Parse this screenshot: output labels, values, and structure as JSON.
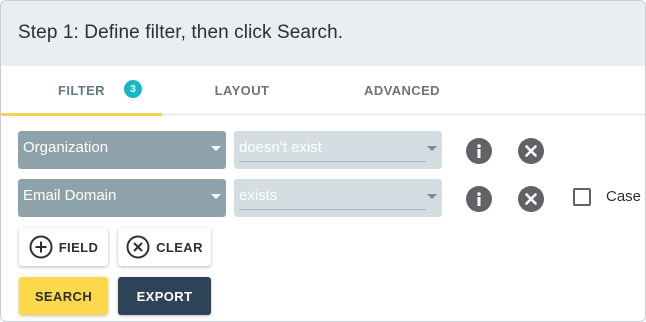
{
  "header": {
    "title": "Step 1: Define filter, then click Search."
  },
  "tabs": [
    {
      "label": "FILTER",
      "badge": "3",
      "active": true
    },
    {
      "label": "LAYOUT",
      "active": false
    },
    {
      "label": "ADVANCED",
      "active": false
    }
  ],
  "filters": [
    {
      "field": "Organization",
      "operator": "doesn't exist",
      "info_icon": "info-icon",
      "remove_icon": "close-icon"
    },
    {
      "field": "Email Domain",
      "operator": "exists",
      "info_icon": "info-icon",
      "remove_icon": "close-icon",
      "option_label": "Case",
      "option_checked": false
    }
  ],
  "actions": {
    "add_field": "FIELD",
    "clear": "CLEAR",
    "search": "SEARCH",
    "export": "EXPORT"
  },
  "colors": {
    "header_bg": "#e9eef2",
    "tab_underline": "#f2d35a",
    "badge": "#17b6c9",
    "field_select": "#8ea2ab",
    "operator_select": "#d4dde1",
    "search_button": "#fdd84a",
    "export_button": "#2e4358"
  }
}
